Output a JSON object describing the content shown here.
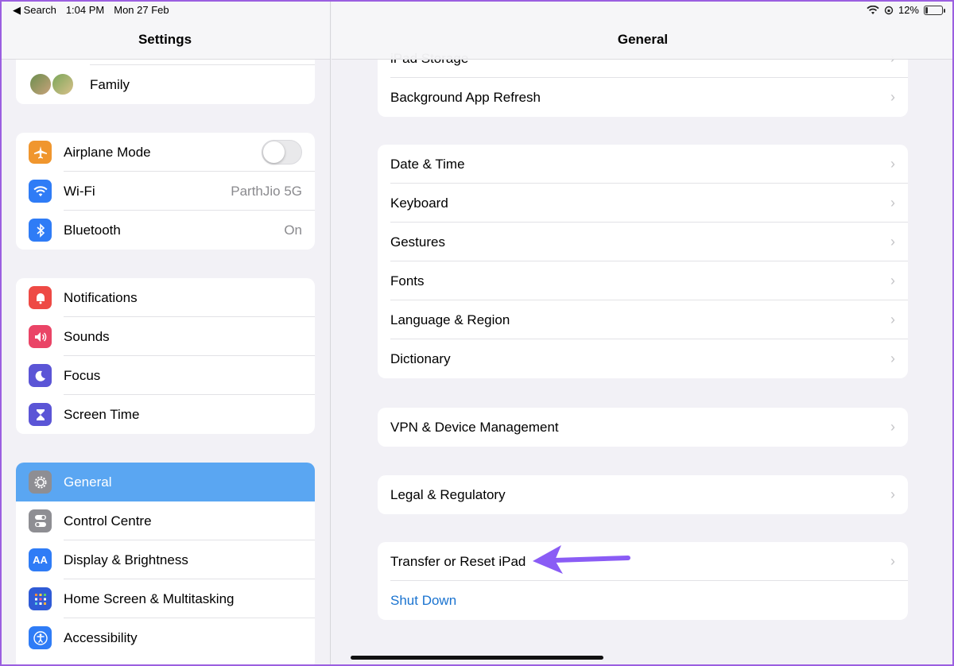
{
  "status_bar": {
    "back_label": "◀ Search",
    "time": "1:04 PM",
    "date": "Mon 27 Feb",
    "battery": "12%"
  },
  "sidebar": {
    "title": "Settings",
    "family_label": "Family",
    "groups": [
      [
        {
          "label": "Airplane Mode",
          "icon": "airplane-icon",
          "color": "#f0962e",
          "toggle": "off"
        },
        {
          "label": "Wi-Fi",
          "icon": "wifi-icon",
          "color": "#2f7cf6",
          "value": "ParthJio 5G"
        },
        {
          "label": "Bluetooth",
          "icon": "bluetooth-icon",
          "color": "#2f7cf6",
          "value": "On"
        }
      ],
      [
        {
          "label": "Notifications",
          "icon": "bell-icon",
          "color": "#ee4a45"
        },
        {
          "label": "Sounds",
          "icon": "speaker-icon",
          "color": "#ea4466"
        },
        {
          "label": "Focus",
          "icon": "moon-icon",
          "color": "#5b55d6"
        },
        {
          "label": "Screen Time",
          "icon": "hourglass-icon",
          "color": "#5b55d6"
        }
      ],
      [
        {
          "label": "General",
          "icon": "gear-icon",
          "color": "#8e8e93",
          "selected": true
        },
        {
          "label": "Control Centre",
          "icon": "switches-icon",
          "color": "#8e8e93"
        },
        {
          "label": "Display & Brightness",
          "icon": "text-size-icon",
          "color": "#2f7cf6",
          "glyph": "AA"
        },
        {
          "label": "Home Screen & Multitasking",
          "icon": "grid-icon",
          "color": "#2f5bd6"
        },
        {
          "label": "Accessibility",
          "icon": "accessibility-icon",
          "color": "#2f7cf6"
        }
      ]
    ]
  },
  "detail": {
    "title": "General",
    "partial_top": "iPad Storage",
    "groups": [
      [
        "Background App Refresh"
      ],
      [
        "Date & Time",
        "Keyboard",
        "Gestures",
        "Fonts",
        "Language & Region",
        "Dictionary"
      ],
      [
        "VPN & Device Management"
      ],
      [
        "Legal & Regulatory"
      ]
    ],
    "transfer_label": "Transfer or Reset iPad",
    "shutdown_label": "Shut Down",
    "chevron": "›"
  }
}
